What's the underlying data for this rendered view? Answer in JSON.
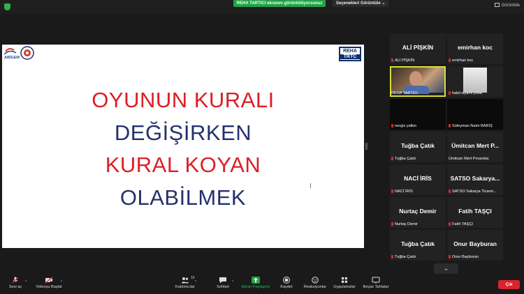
{
  "topbar": {
    "share_banner": "REHA TARTICI ekranını görüntülüyorsunuz",
    "view_options": "Seçenekleri Görüntüle",
    "view_options_caret": "⌄",
    "view_button": "Görüntüle"
  },
  "slide": {
    "logo_left_text": "ABİGEM",
    "logo_right_line1": "REHA",
    "logo_right_line2": "TRTC",
    "lines": [
      "OYUNUN KURALI",
      "DEĞİŞİRKEN",
      "KURAL KOYAN",
      "OLABİLMEK"
    ],
    "colors": {
      "red": "#dc1f26",
      "navy": "#24306e"
    }
  },
  "participants": [
    {
      "name": "ALİ PİŞKİN",
      "label": "ALİ PİŞKİN"
    },
    {
      "name": "emirhan koc",
      "label": "emirhan koc"
    },
    {
      "name": "",
      "label": "REHA TARTICI"
    },
    {
      "name": "",
      "label": "habil siyami polat"
    },
    {
      "name": "",
      "label": "nergis yalkın"
    },
    {
      "name": "",
      "label": "Süleyman Naim BARIŞ"
    },
    {
      "name": "Tuğba Çatık",
      "label": "Tuğba Çatık"
    },
    {
      "name": "Ümitcan Mert P...",
      "label": "Ümitcan Mert Pınaroba"
    },
    {
      "name": "NACİ İRİS",
      "label": "NACİ İRİS"
    },
    {
      "name": "SATSO Sakarya...",
      "label": "SATSO Sakarya Ticaret..."
    },
    {
      "name": "Nurtaç Demir",
      "label": "Nurtaç Demir"
    },
    {
      "name": "Fatih TAŞÇI",
      "label": "Fatih TAŞÇI"
    },
    {
      "name": "Tuğba Çatık",
      "label": "Tuğba Çatık"
    },
    {
      "name": "Onur Bayburan",
      "label": "Onur Bayburan"
    }
  ],
  "scroll_down": "⌄",
  "toolbar": {
    "audio": "Sesi aç",
    "video": "Videoyu Başlat",
    "participants": "Katılımcılar",
    "participants_count": "16",
    "chat": "Sohbet",
    "share": "Ekran Paylaşımı",
    "record": "Kaydet",
    "reactions": "Reaksiyonlar",
    "apps": "Uygulamalar",
    "whiteboard": "Beyaz Tahtalar",
    "caret": "^",
    "end": "Çık"
  }
}
